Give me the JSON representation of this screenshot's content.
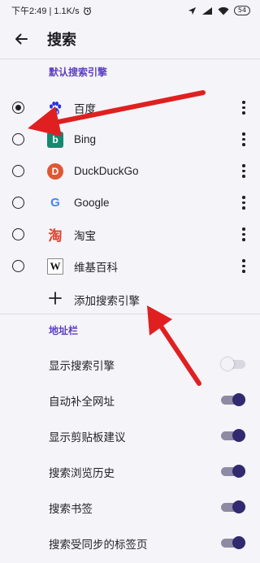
{
  "status_bar": {
    "time_speed": "下午2:49 | 1.1K/s",
    "battery": "54"
  },
  "app_bar": {
    "title": "搜索"
  },
  "default_engine_section": {
    "title": "默认搜索引擎",
    "engines": [
      {
        "label": "百度",
        "icon": "baidu-paw-icon",
        "selected": true
      },
      {
        "label": "Bing",
        "icon": "bing-icon",
        "selected": false
      },
      {
        "label": "DuckDuckGo",
        "icon": "duckduckgo-icon",
        "selected": false
      },
      {
        "label": "Google",
        "icon": "google-icon",
        "selected": false
      },
      {
        "label": "淘宝",
        "icon": "taobao-icon",
        "selected": false
      },
      {
        "label": "维基百科",
        "icon": "wikipedia-icon",
        "selected": false
      }
    ],
    "add_label": "添加搜索引擎"
  },
  "address_bar_section": {
    "title": "地址栏",
    "options": [
      {
        "label": "显示搜索引擎",
        "enabled": false
      },
      {
        "label": "自动补全网址",
        "enabled": true
      },
      {
        "label": "显示剪贴板建议",
        "enabled": true
      },
      {
        "label": "搜索浏览历史",
        "enabled": true
      },
      {
        "label": "搜索书签",
        "enabled": true
      },
      {
        "label": "搜索受同步的标签页",
        "enabled": true
      }
    ]
  },
  "icon_glyphs": {
    "bing": "b",
    "duckduckgo": "D",
    "google": "G",
    "taobao": "淘",
    "wikipedia": "W"
  },
  "colors": {
    "accent": "#5c3fc0",
    "toggle_on_thumb": "#312a70",
    "annotation_arrow": "#e02020",
    "bing": "#138a72",
    "duckduckgo": "#de5833",
    "google_blue": "#4285f4",
    "taobao": "#e0402a",
    "baidu": "#2932e1"
  }
}
